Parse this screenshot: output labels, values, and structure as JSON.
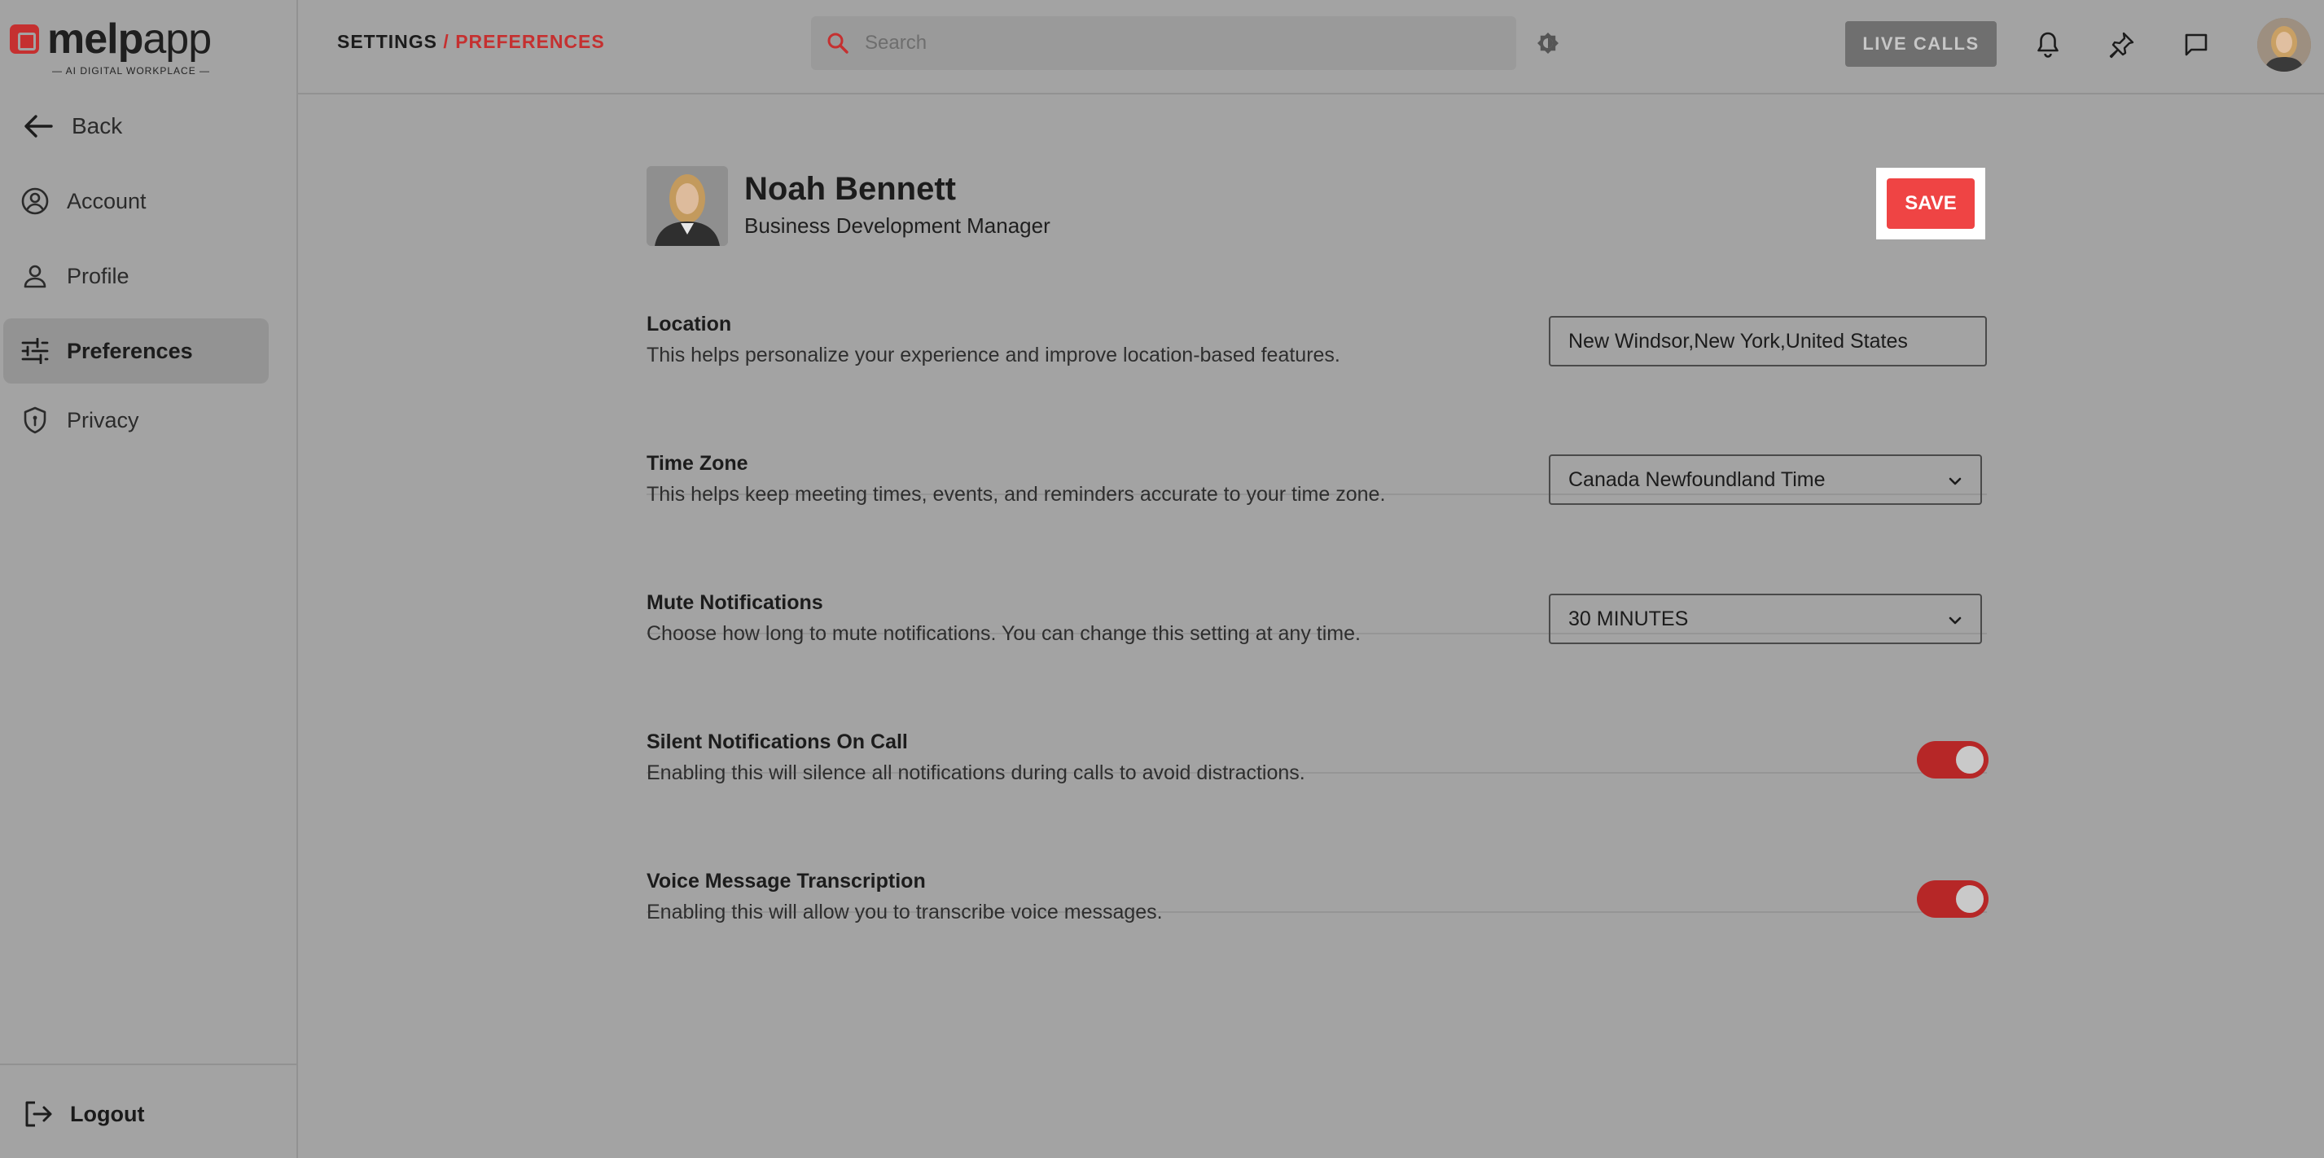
{
  "brand": {
    "name_bold": "melp",
    "name_light": "app",
    "tagline": "— AI DIGITAL WORKPLACE —"
  },
  "sidebar": {
    "back_label": "Back",
    "items": [
      {
        "label": "Account",
        "icon": "account-circle-icon"
      },
      {
        "label": "Profile",
        "icon": "person-icon"
      },
      {
        "label": "Preferences",
        "icon": "sliders-icon",
        "active": true
      },
      {
        "label": "Privacy",
        "icon": "shield-icon"
      }
    ],
    "logout_label": "Logout"
  },
  "header": {
    "breadcrumb_root": "SETTINGS",
    "breadcrumb_sep": " / ",
    "breadcrumb_current": "PREFERENCES",
    "search_placeholder": "Search",
    "live_calls_label": "LIVE CALLS"
  },
  "profile": {
    "name": "Noah Bennett",
    "role": "Business Development Manager",
    "save_label": "SAVE"
  },
  "settings": {
    "location": {
      "label": "Location",
      "desc": "This helps personalize your experience and improve location-based features.",
      "value": "New Windsor,New York,United States"
    },
    "timezone": {
      "label": "Time Zone",
      "desc": "This helps keep meeting times, events, and reminders accurate to your time zone.",
      "value": "Canada Newfoundland Time"
    },
    "mute": {
      "label": "Mute Notifications",
      "desc": "Choose how long to mute notifications. You can change this setting at any time.",
      "value": "30 MINUTES"
    },
    "silent": {
      "label": "Silent Notifications On Call",
      "desc": "Enabling this will silence all notifications during calls to avoid distractions.",
      "enabled": true
    },
    "transcription": {
      "label": "Voice Message Transcription",
      "desc": "Enabling this will allow you to transcribe voice messages.",
      "enabled": true
    }
  },
  "colors": {
    "accent": "#c53030",
    "save": "#ef4444",
    "toggle_on": "#b62727",
    "background": "#a3a3a3"
  }
}
